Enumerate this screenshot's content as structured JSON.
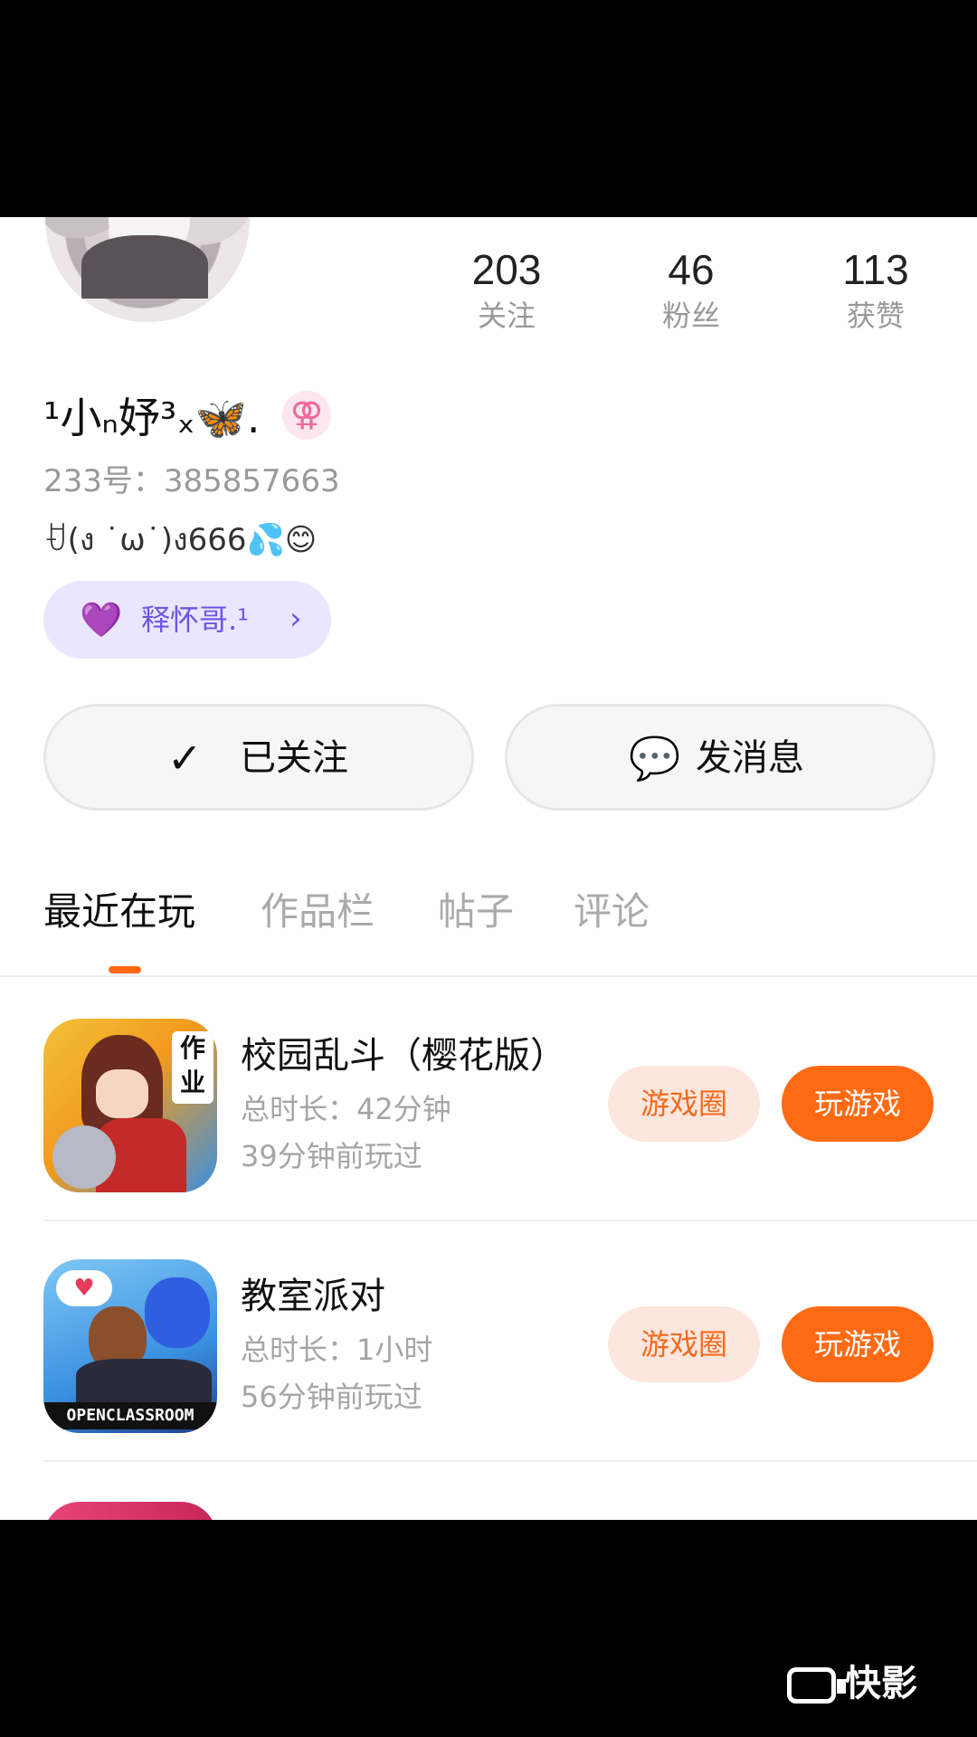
{
  "profile": {
    "name": "¹小ₙ妤³ₓ🦋.",
    "gender_symbol": "⚢",
    "uid": "233号：385857663",
    "bio": "ꀀ(ง ˙ω˙)ง666💦😊"
  },
  "stats": [
    {
      "num": "203",
      "label": "关注"
    },
    {
      "num": "46",
      "label": "粉丝"
    },
    {
      "num": "113",
      "label": "获赞"
    }
  ],
  "tag_chip": {
    "label": "释怀哥.¹",
    "heart": "💜",
    "chevron": "›"
  },
  "buttons": {
    "follow_icon": "✓",
    "follow_label": "已关注",
    "message_icon": "💬",
    "message_label": "发消息"
  },
  "tabs": [
    "最近在玩",
    "作品栏",
    "帖子",
    "评论"
  ],
  "games": [
    {
      "title": "校园乱斗（樱花版）",
      "total_time": "总时长：42分钟",
      "last_played": "39分钟前玩过",
      "circle_label": "游戏圈",
      "play_label": "玩游戏",
      "icon_text": "作业"
    },
    {
      "title": "教室派对",
      "total_time": "总时长：1小时",
      "last_played": "56分钟前玩过",
      "circle_label": "游戏圈",
      "play_label": "玩游戏",
      "icon_text": "OPENCLASSROOM"
    }
  ],
  "watermark": "快影",
  "colors": {
    "accent": "#ff6a13",
    "accent_soft": "#fde6dd",
    "tag_bg": "#ebe6ff",
    "tag_fg": "#6a56e8"
  }
}
